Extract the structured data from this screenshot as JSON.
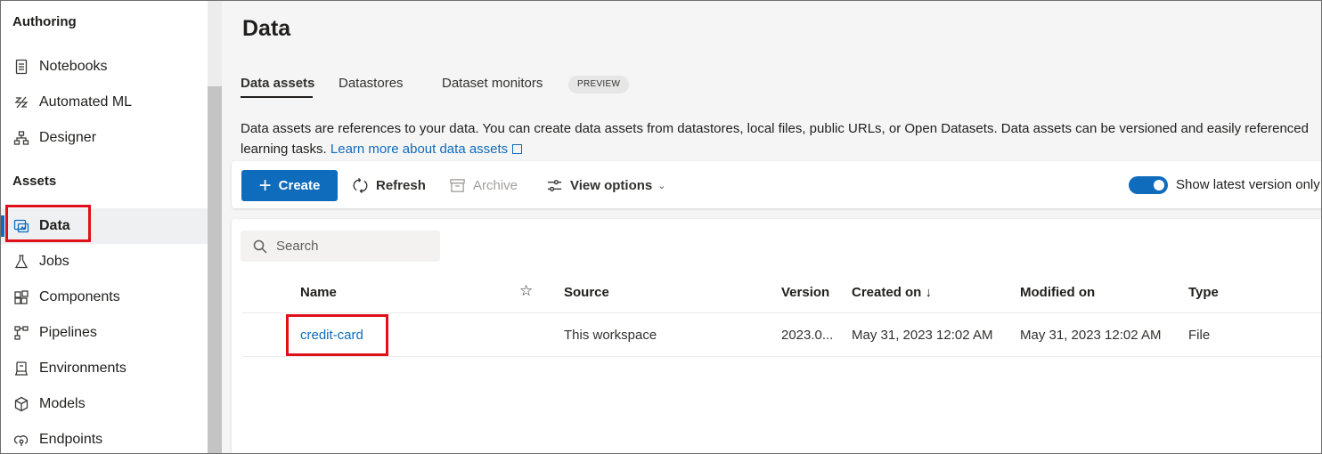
{
  "sidebar": {
    "sections": [
      {
        "label": "Authoring"
      },
      {
        "label": "Assets"
      }
    ],
    "authoring_items": [
      {
        "label": "Notebooks",
        "icon": "notebook-icon"
      },
      {
        "label": "Automated ML",
        "icon": "automated-ml-icon"
      },
      {
        "label": "Designer",
        "icon": "designer-icon"
      }
    ],
    "asset_items": [
      {
        "label": "Data",
        "icon": "data-icon",
        "active": true
      },
      {
        "label": "Jobs",
        "icon": "flask-icon"
      },
      {
        "label": "Components",
        "icon": "components-icon"
      },
      {
        "label": "Pipelines",
        "icon": "pipelines-icon"
      },
      {
        "label": "Environments",
        "icon": "environments-icon"
      },
      {
        "label": "Models",
        "icon": "models-icon"
      },
      {
        "label": "Endpoints",
        "icon": "endpoints-icon"
      }
    ]
  },
  "main": {
    "title": "Data",
    "tabs": [
      {
        "label": "Data assets",
        "active": true
      },
      {
        "label": "Datastores"
      },
      {
        "label": "Dataset monitors"
      }
    ],
    "preview_badge": "PREVIEW",
    "description": "Data assets are references to your data. You can create data assets from datastores, local files, public URLs, or Open Datasets. Data assets can be versioned and easily referenced",
    "description_line2": "learning tasks.",
    "learn_more": "Learn more about data assets"
  },
  "toolbar": {
    "create_label": "Create",
    "refresh_label": "Refresh",
    "archive_label": "Archive",
    "view_options_label": "View options",
    "toggle_label": "Show latest version only",
    "toggle_on": true
  },
  "search": {
    "placeholder": "Search"
  },
  "table": {
    "columns": [
      "Name",
      "Source",
      "Version",
      "Created on ↓",
      "Modified on",
      "Type"
    ],
    "rows": [
      {
        "name": "credit-card",
        "source": "This workspace",
        "version": "2023.0...",
        "created_on": "May 31, 2023 12:02 AM",
        "modified_on": "May 31, 2023 12:02 AM",
        "type": "File"
      }
    ]
  },
  "colors": {
    "accent": "#0f6cbd",
    "highlight": "#e0101a"
  }
}
